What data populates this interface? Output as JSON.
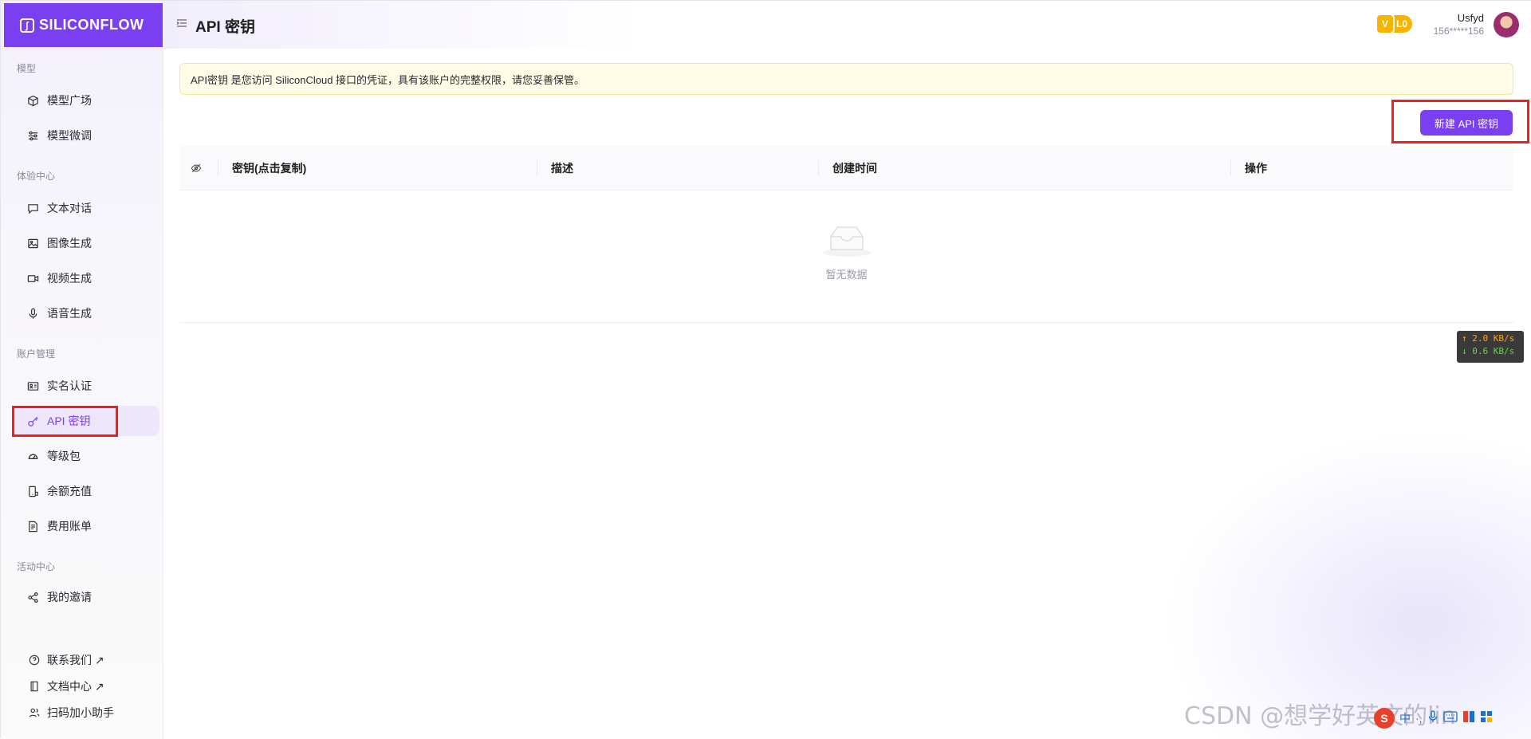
{
  "brand": {
    "name": "SILICONFLOW"
  },
  "sidebar": {
    "sections": [
      {
        "title": "模型"
      },
      {
        "title": "体验中心"
      },
      {
        "title": "账户管理"
      },
      {
        "title": "活动中心"
      }
    ],
    "items": [
      {
        "label": "模型广场",
        "icon": "cube-icon"
      },
      {
        "label": "模型微调",
        "icon": "sliders-icon"
      },
      {
        "label": "文本对话",
        "icon": "chat-icon"
      },
      {
        "label": "图像生成",
        "icon": "image-icon"
      },
      {
        "label": "视频生成",
        "icon": "video-icon"
      },
      {
        "label": "语音生成",
        "icon": "mic-icon"
      },
      {
        "label": "实名认证",
        "icon": "id-card-icon"
      },
      {
        "label": "API 密钥",
        "icon": "key-icon",
        "active": true
      },
      {
        "label": "等级包",
        "icon": "gauge-icon"
      },
      {
        "label": "余额充值",
        "icon": "wallet-icon"
      },
      {
        "label": "费用账单",
        "icon": "bill-icon"
      },
      {
        "label": "我的邀请",
        "icon": "share-icon"
      }
    ],
    "footer": [
      {
        "label": "联系我们 ↗",
        "icon": "help-circle-icon"
      },
      {
        "label": "文档中心 ↗",
        "icon": "book-icon"
      },
      {
        "label": "扫码加小助手",
        "icon": "users-icon"
      }
    ]
  },
  "header": {
    "title": "API 密钥",
    "level_badge": "L0",
    "level_mark": "V",
    "user_name": "Usfyd",
    "user_phone": "156*****156"
  },
  "main": {
    "notice": "API密钥 是您访问 SiliconCloud 接口的凭证，具有该账户的完整权限，请您妥善保管。",
    "create_button": "新建 API 密钥",
    "table": {
      "columns": [
        "密钥(点击复制)",
        "描述",
        "创建时间",
        "操作"
      ],
      "rows": [],
      "empty_text": "暂无数据"
    }
  },
  "overlay": {
    "net_up": "↑ 2.0 KB/s",
    "net_down": "↓ 0.6 KB/s",
    "watermark": "CSDN @想学好英文的lin",
    "ime_items": [
      "中",
      "·,"
    ]
  },
  "colors": {
    "accent": "#7a3ff0",
    "highlight_outline": "#ef1f1f",
    "notice_bg": "#fefbe6",
    "badge": "#f4b400"
  }
}
